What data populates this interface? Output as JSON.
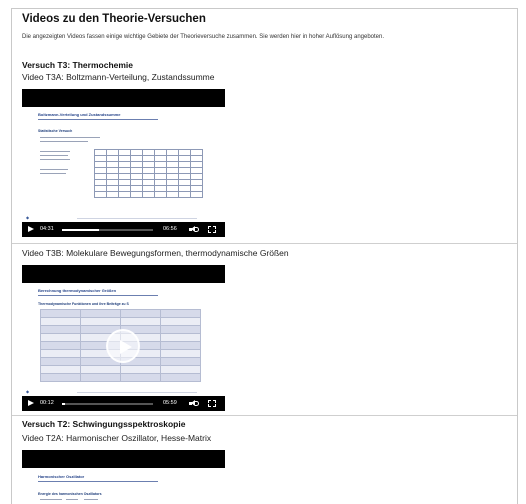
{
  "page": {
    "title": "Videos zu den Theorie-Versuchen",
    "intro": "Die angezeigten Videos fassen einige wichtige Gebiete der Theorieversuche zusammen. Sie werden hier in hoher Auflösung angeboten."
  },
  "sections": [
    {
      "heading": "Versuch T3: Thermochemie",
      "videos": [
        {
          "title": "Video T3A: Boltzmann-Verteilung, Zustandssumme",
          "slide_title": "Boltzmann-Verteilung und Zustandssumme",
          "slide_subtitle": "Statistische Versuch",
          "time_current": "04:31",
          "time_total": "06:56",
          "progress": 0.41
        },
        {
          "title": "Video T3B: Molekulare Bewegungsformen, thermodynamische Größen",
          "slide_title": "Berechnung thermodynamischer Größen",
          "slide_subtitle": "Thermodynamische Funktionen und ihre Beiträge zu S",
          "time_current": "00:12",
          "time_total": "05:59",
          "progress": 0.03
        }
      ]
    },
    {
      "heading": "Versuch T2: Schwingungsspektroskopie",
      "videos": [
        {
          "title": "Video T2A: Harmonischer Oszillator, Hesse-Matrix",
          "slide_title": "Harmonischer Oszillator",
          "slide_subtitle": "Energie des harmonischen Oszillators"
        }
      ]
    }
  ],
  "icons": {
    "play": "play-icon",
    "volume": "volume-icon",
    "fullscreen": "fullscreen-icon",
    "big_play": "big-play-icon"
  },
  "colors": {
    "slide_accent": "#27458a",
    "player_bar": "#000000",
    "divider": "#cfcfcf"
  }
}
